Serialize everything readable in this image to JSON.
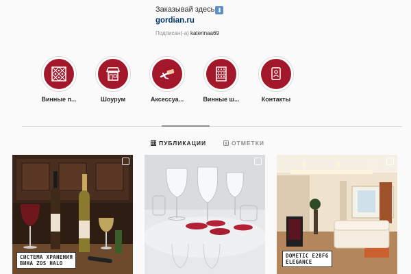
{
  "profile": {
    "bio_text": "Заказывай здесь",
    "bio_icon": "down-arrow-emoji-icon",
    "link": "gordian.ru",
    "followed_prefix": "Подписан(-а)",
    "followed_user": "katerinaa69"
  },
  "highlights": [
    {
      "label": "Винные п...",
      "icon": "wine-grid-icon"
    },
    {
      "label": "Шоурум",
      "icon": "storefront-icon"
    },
    {
      "label": "Аксессуа...",
      "icon": "corkscrew-icon"
    },
    {
      "label": "Винные ш...",
      "icon": "wine-cabinet-icon"
    },
    {
      "label": "Контакты",
      "icon": "contact-card-icon"
    }
  ],
  "tabs": [
    {
      "label": "ПУБЛИКАЦИИ",
      "icon": "grid-icon",
      "active": true
    },
    {
      "label": "ОТМЕТКИ",
      "icon": "tag-icon",
      "active": false
    }
  ],
  "posts": [
    {
      "caption_line1": "СИСТЕМА ХРАНЕНИЯ",
      "caption_line2": "ВИНА ZOS HALO",
      "badge": "multiple-posts-icon"
    },
    {
      "caption_line1": "",
      "caption_line2": "",
      "badge": "multiple-posts-icon"
    },
    {
      "caption_line1": "DOMETIC E28FG",
      "caption_line2": "ELEGANCE",
      "badge": "multiple-posts-icon"
    }
  ],
  "colors": {
    "accent": "#a2182a",
    "link": "#00376b",
    "muted": "#8e8e8e"
  }
}
